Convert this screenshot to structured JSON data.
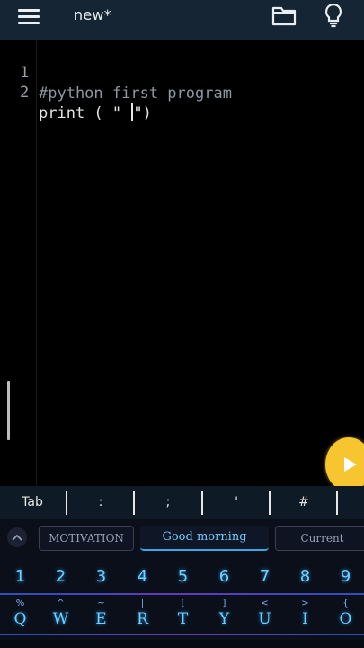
{
  "topbar": {
    "file_title": "new*",
    "icons": [
      "menu-icon",
      "folder-icon",
      "lightbulb-icon"
    ],
    "background": "#152534"
  },
  "editor": {
    "lines": [
      {
        "number": "1",
        "text": "#python first program"
      },
      {
        "number": "2",
        "text_before_cursor": "print ( \" ",
        "text_after_cursor": "\")"
      }
    ],
    "run_button_icon": "play-icon",
    "run_button_color": "#f6c530"
  },
  "extra_keys": [
    "Tab",
    ":",
    ";",
    "'",
    "#"
  ],
  "keyboard": {
    "suggestions": [
      "MOTIVATION",
      "Good morning",
      "Current"
    ],
    "number_row": [
      "1",
      "2",
      "3",
      "4",
      "5",
      "6",
      "7",
      "8",
      "9"
    ],
    "alt_row": [
      "%",
      "^",
      "~",
      "|",
      "[",
      "]",
      "<",
      ">",
      "{"
    ],
    "letter_row": [
      "Q",
      "W",
      "E",
      "R",
      "T",
      "Y",
      "U",
      "I",
      "O"
    ],
    "accent_color": "#6fd0ff"
  }
}
